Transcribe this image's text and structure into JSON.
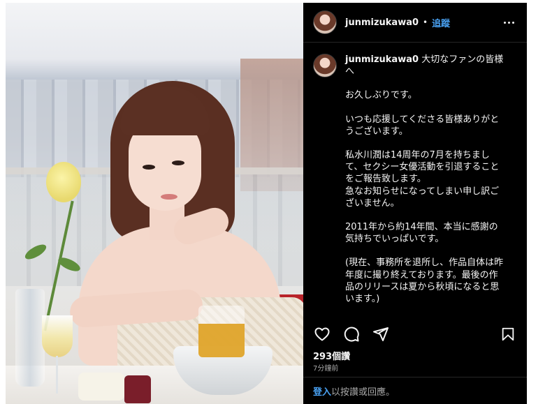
{
  "post": {
    "username": "junmizukawa0",
    "dot": "•",
    "follow_label": "追蹤",
    "caption_first_line": "大切なファンの皆様へ",
    "caption_paragraphs": [
      "お久しぶりです。",
      "いつも応援してくださる皆様ありがとうございます。",
      "私水川潤は14周年の7月を持ちまして、セクシー女優活動を引退することをご報告致します。\n急なお知らせになってしまい申し訳ございません。",
      "2011年から約14年間、本当に感謝の気持ちでいっぱいです。",
      "(現在、事務所を退所し、作品自体は昨年度に撮り終えております。最後の作品のリリースは夏から秋頃になると思います。)"
    ],
    "likes": "293個讚",
    "time_ago": "7分鐘前",
    "footer": {
      "login_label": "登入",
      "rest": "以按讚或回應。"
    }
  },
  "icons": {
    "like": "heart-icon",
    "comment": "comment-icon",
    "share": "send-icon",
    "save": "bookmark-icon",
    "more": "more-horizontal-icon"
  },
  "colors": {
    "panel_bg": "#000000",
    "link_blue": "#4aa3f5",
    "text": "#f5f5f5",
    "muted": "#a8a8a8"
  }
}
